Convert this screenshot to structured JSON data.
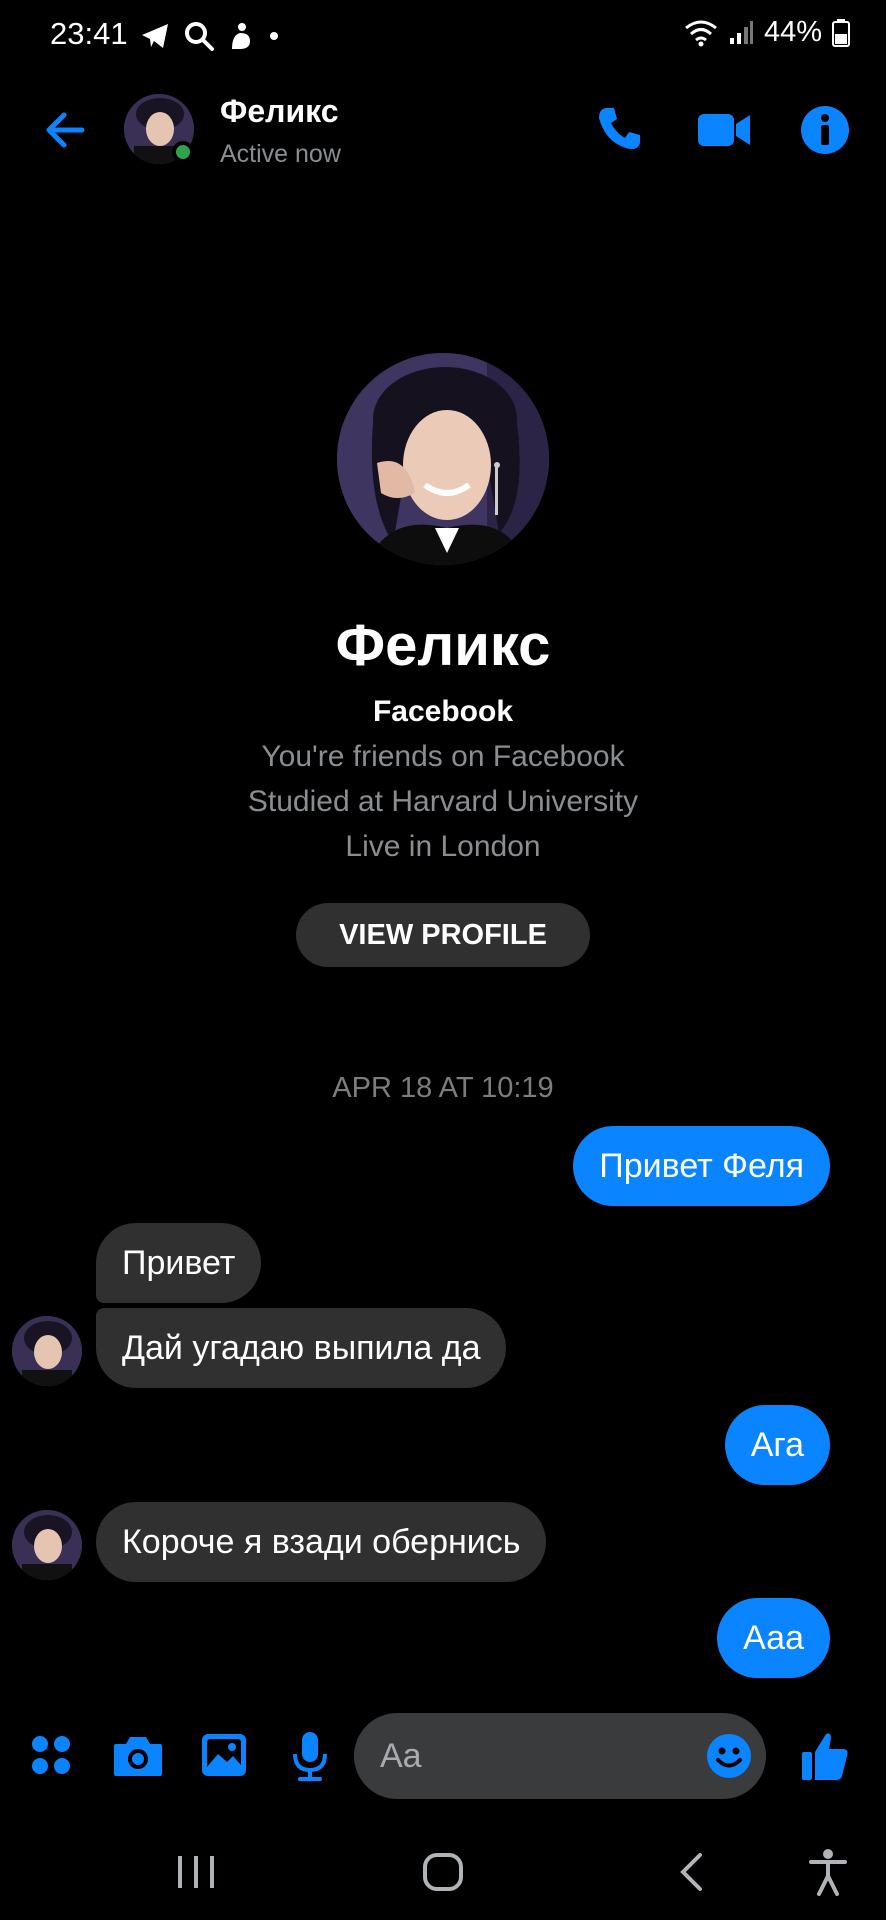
{
  "status_bar": {
    "time": "23:41",
    "battery": "44%",
    "icons": [
      "telegram-icon",
      "search-icon",
      "notification-icon",
      "dot-icon",
      "wifi-icon",
      "signal-icon",
      "battery-icon"
    ]
  },
  "header": {
    "name": "Феликс",
    "status": "Active now",
    "accent": "#0a84ff"
  },
  "profile": {
    "name": "Феликс",
    "platform": "Facebook",
    "lines": [
      "You're friends on Facebook",
      "Studied at Harvard University",
      "Live in London"
    ],
    "button": "VIEW PROFILE"
  },
  "conversation": {
    "timestamp": "APR 18 AT 10:19",
    "messages": [
      {
        "from": "me",
        "text": "Привет Феля"
      },
      {
        "from": "them",
        "text": "Привет"
      },
      {
        "from": "them",
        "text": "Дай угадаю выпила да"
      },
      {
        "from": "me",
        "text": "Ага"
      },
      {
        "from": "them",
        "text": "Короче я взади обернись"
      },
      {
        "from": "me",
        "text": "Ааа"
      }
    ]
  },
  "composer": {
    "placeholder": "Aa"
  }
}
